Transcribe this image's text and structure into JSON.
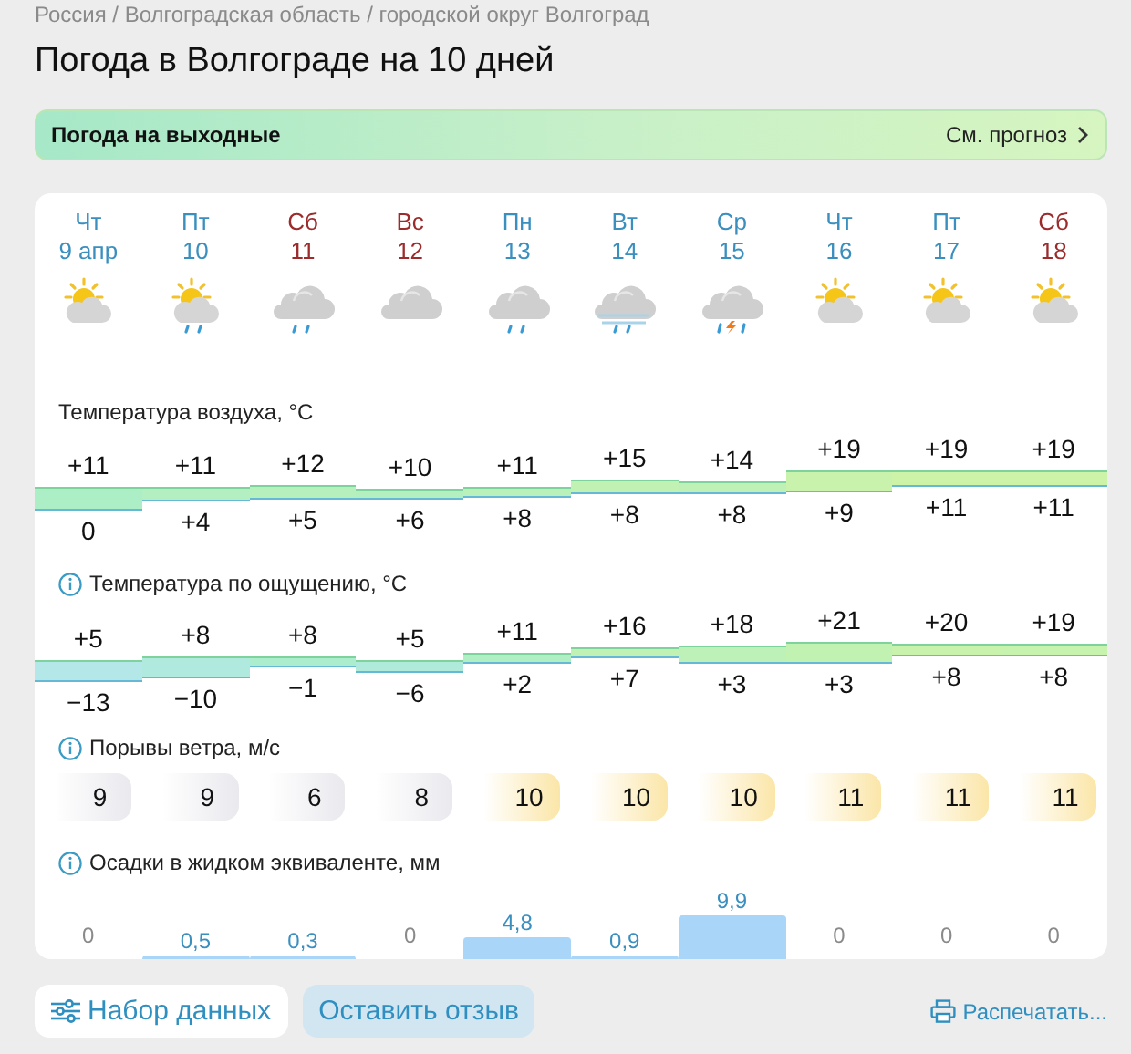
{
  "breadcrumb": "Россия / Волгоградская область / городской округ Волгоград",
  "title": "Погода в Волгограде на 10 дней",
  "banner": {
    "title": "Погода на выходные",
    "link": "См. прогноз"
  },
  "days": [
    {
      "weekday": "Чт",
      "date": "9 апр",
      "weekend": false,
      "kind": "sun"
    },
    {
      "weekday": "Пт",
      "date": "10",
      "weekend": false,
      "kind": "sunrain"
    },
    {
      "weekday": "Сб",
      "date": "11",
      "weekend": true,
      "kind": "rain"
    },
    {
      "weekday": "Вс",
      "date": "12",
      "weekend": true,
      "kind": "overcast"
    },
    {
      "weekday": "Пн",
      "date": "13",
      "weekend": false,
      "kind": "rain"
    },
    {
      "weekday": "Вт",
      "date": "14",
      "weekend": false,
      "kind": "fog"
    },
    {
      "weekday": "Ср",
      "date": "15",
      "weekend": false,
      "kind": "storm"
    },
    {
      "weekday": "Чт",
      "date": "16",
      "weekend": false,
      "kind": "sun"
    },
    {
      "weekday": "Пт",
      "date": "17",
      "weekend": false,
      "kind": "sun"
    },
    {
      "weekday": "Сб",
      "date": "18",
      "weekend": true,
      "kind": "sun"
    }
  ],
  "sections": [
    {
      "kind": "temperature",
      "label": "Температура воздуха, °C",
      "info": false,
      "values": [
        {
          "max": "+11",
          "min": "0"
        },
        {
          "max": "+11",
          "min": "+4"
        },
        {
          "max": "+12",
          "min": "+5"
        },
        {
          "max": "+10",
          "min": "+6"
        },
        {
          "max": "+11",
          "min": "+8"
        },
        {
          "max": "+15",
          "min": "+8"
        },
        {
          "max": "+14",
          "min": "+8"
        },
        {
          "max": "+19",
          "min": "+9"
        },
        {
          "max": "+19",
          "min": "+11"
        },
        {
          "max": "+19",
          "min": "+11"
        }
      ]
    },
    {
      "kind": "temperature",
      "label": "Температура по ощущению, °C",
      "info": true,
      "values": [
        {
          "max": "+5",
          "min": "−13"
        },
        {
          "max": "+8",
          "min": "−10"
        },
        {
          "max": "+8",
          "min": "−1"
        },
        {
          "max": "+5",
          "min": "−6"
        },
        {
          "max": "+11",
          "min": "+2"
        },
        {
          "max": "+16",
          "min": "+7"
        },
        {
          "max": "+18",
          "min": "+3"
        },
        {
          "max": "+21",
          "min": "+3"
        },
        {
          "max": "+20",
          "min": "+8"
        },
        {
          "max": "+19",
          "min": "+8"
        }
      ]
    },
    {
      "kind": "wind",
      "label": "Порывы ветра, м/с",
      "info": true,
      "values": [
        {
          "value": "9",
          "strong": false
        },
        {
          "value": "9",
          "strong": false
        },
        {
          "value": "6",
          "strong": false
        },
        {
          "value": "8",
          "strong": false
        },
        {
          "value": "10",
          "strong": true
        },
        {
          "value": "10",
          "strong": true
        },
        {
          "value": "10",
          "strong": true
        },
        {
          "value": "11",
          "strong": true
        },
        {
          "value": "11",
          "strong": true
        },
        {
          "value": "11",
          "strong": true
        }
      ]
    },
    {
      "kind": "precipitation",
      "label": "Осадки в жидком эквиваленте, мм",
      "info": true,
      "values": [
        {
          "value": "0"
        },
        {
          "value": "0,5"
        },
        {
          "value": "0,3"
        },
        {
          "value": "0"
        },
        {
          "value": "4,8"
        },
        {
          "value": "0,9"
        },
        {
          "value": "9,9"
        },
        {
          "value": "0"
        },
        {
          "value": "0"
        },
        {
          "value": "0"
        }
      ]
    }
  ],
  "footer": {
    "dataset_button": "Набор данных",
    "feedback_button": "Оставить отзыв",
    "print_link": "Распечатать..."
  }
}
